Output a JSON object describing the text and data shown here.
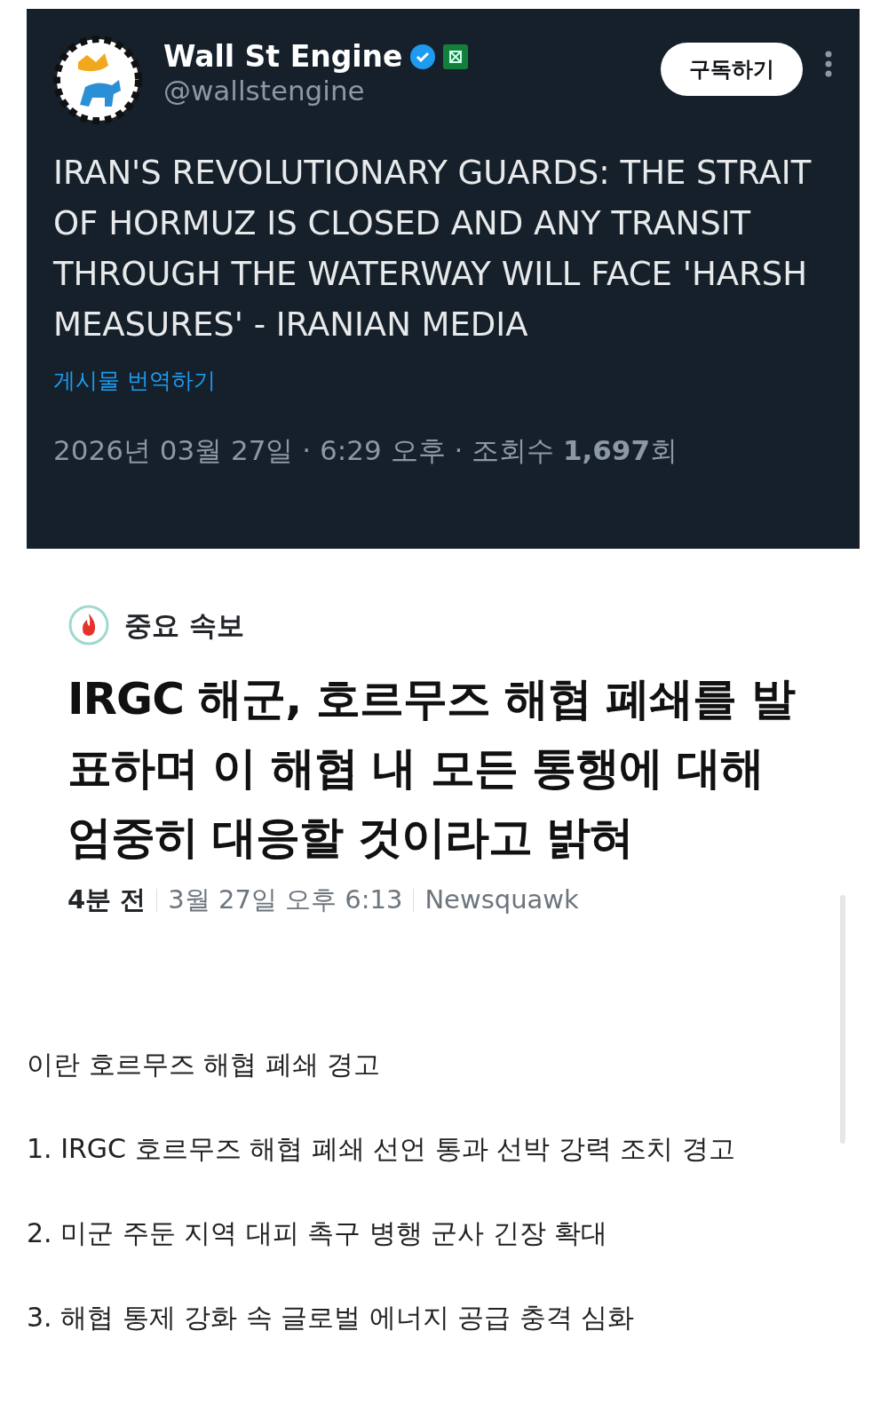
{
  "tweet": {
    "author": "Wall St Engine",
    "verified": true,
    "handle": "@wallstengine",
    "subscribe_button": "구독하기",
    "text": "IRAN'S REVOLUTIONARY GUARDS: THE STRAIT OF HORMUZ IS CLOSED AND ANY TRANSIT THROUGH THE WATERWAY WILL FACE 'HARSH MEASURES' - IRANIAN MEDIA",
    "translate_link": "게시물 번역하기",
    "meta": "2026년 03월 27일 · 6:29 오후 · 조회수 **1,697**회"
  },
  "article": {
    "badge": "중요 속보",
    "headline": "IRGC 해군, 호르무즈 해협 폐쇄를 발표하며 이 해협 내 모든 통행에 대해 엄중히 대응할 것이라고 밝혀",
    "age": "4분 전",
    "datetime": "3월 27일 오후 6:13",
    "source": "Newsquawk"
  },
  "summary": {
    "title": "이란 호르무즈 해협 폐쇄 경고",
    "points": [
      "1. IRGC 호르무즈 해협 폐쇄 선언 통과 선박 강력 조치 경고",
      "2. 미군 주둔 지역 대피 촉구 병행 군사 긴장 확대",
      "3. 해협 통제 강화 속 글로벌 에너지 공급 충격 심화"
    ]
  }
}
